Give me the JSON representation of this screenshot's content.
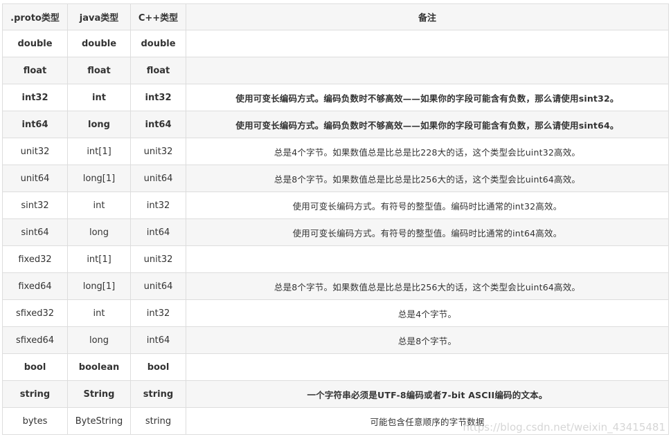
{
  "table": {
    "headers": [
      ".proto类型",
      "java类型",
      "C++类型",
      "备注"
    ],
    "rows": [
      {
        "proto": "double",
        "java": "double",
        "cpp": "double",
        "note": "",
        "bold": true
      },
      {
        "proto": "float",
        "java": "float",
        "cpp": "float",
        "note": "",
        "bold": true
      },
      {
        "proto": "int32",
        "java": "int",
        "cpp": "int32",
        "note": "使用可变长编码方式。编码负数时不够高效——如果你的字段可能含有负数，那么请使用sint32。",
        "bold": true
      },
      {
        "proto": "int64",
        "java": "long",
        "cpp": "int64",
        "note": "使用可变长编码方式。编码负数时不够高效——如果你的字段可能含有负数，那么请使用sint64。",
        "bold": true
      },
      {
        "proto": "unit32",
        "java": "int[1]",
        "cpp": "unit32",
        "note": "总是4个字节。如果数值总是比总是比228大的话，这个类型会比uint32高效。",
        "bold": false
      },
      {
        "proto": "unit64",
        "java": "long[1]",
        "cpp": "unit64",
        "note": "总是8个字节。如果数值总是比总是比256大的话，这个类型会比uint64高效。",
        "bold": false
      },
      {
        "proto": "sint32",
        "java": "int",
        "cpp": "int32",
        "note": "使用可变长编码方式。有符号的整型值。编码时比通常的int32高效。",
        "bold": false
      },
      {
        "proto": "sint64",
        "java": "long",
        "cpp": "int64",
        "note": "使用可变长编码方式。有符号的整型值。编码时比通常的int64高效。",
        "bold": false
      },
      {
        "proto": "fixed32",
        "java": "int[1]",
        "cpp": "unit32",
        "note": "",
        "bold": false
      },
      {
        "proto": "fixed64",
        "java": "long[1]",
        "cpp": "unit64",
        "note": "总是8个字节。如果数值总是比总是比256大的话，这个类型会比uint64高效。",
        "bold": false
      },
      {
        "proto": "sfixed32",
        "java": "int",
        "cpp": "int32",
        "note": "总是4个字节。",
        "bold": false
      },
      {
        "proto": "sfixed64",
        "java": "long",
        "cpp": "int64",
        "note": "总是8个字节。",
        "bold": false
      },
      {
        "proto": "bool",
        "java": "boolean",
        "cpp": "bool",
        "note": "",
        "bold": true
      },
      {
        "proto": "string",
        "java": "String",
        "cpp": "string",
        "note": "一个字符串必须是UTF-8编码或者7-bit ASCII编码的文本。",
        "bold": true
      },
      {
        "proto": "bytes",
        "java": "ByteString",
        "cpp": "string",
        "note": "可能包含任意顺序的字节数据",
        "bold": false
      }
    ]
  },
  "watermark": "https://blog.csdn.net/weixin_43415481"
}
